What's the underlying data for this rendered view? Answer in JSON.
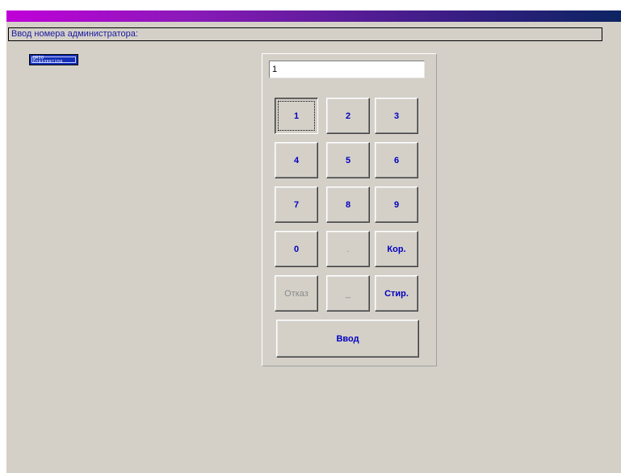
{
  "header": {
    "title": "Ввод номера администратора:"
  },
  "logo": {
    "line1": "BRIO",
    "line2": "Engineering"
  },
  "entry": {
    "value": "1"
  },
  "keypad": {
    "k1": "1",
    "k2": "2",
    "k3": "3",
    "k4": "4",
    "k5": "5",
    "k6": "6",
    "k7": "7",
    "k8": "8",
    "k9": "9",
    "k0": "0",
    "dot": ".",
    "backspace": "Кор.",
    "cancel": "Отказ",
    "underscore": "_",
    "clear": "Стир.",
    "enter": "Ввод"
  },
  "colors": {
    "label_text": "#1a1aa0",
    "key_text": "#0000c0",
    "disabled_text": "#8a8a8a",
    "background": "#d4d0c8",
    "logo_bg": "#1530b8"
  }
}
